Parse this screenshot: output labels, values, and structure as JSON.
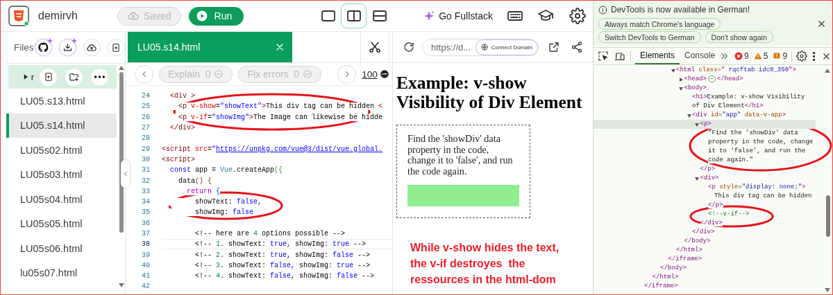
{
  "app_bar": {
    "project_name": "demirvh",
    "saved_button": {
      "label": "Saved",
      "disabled": true
    },
    "run_button": {
      "label": "Run"
    },
    "layouts": [
      {
        "kind": "single",
        "selected": false
      },
      {
        "kind": "columns",
        "selected": true
      },
      {
        "kind": "rows",
        "selected": false
      }
    ],
    "fullstack_button": {
      "label": "Go Fullstack"
    }
  },
  "sidebar": {
    "title": "Files",
    "folder": {
      "name": "r",
      "expanded": false
    },
    "files": [
      {
        "name": "LU05.s13.html",
        "selected": false
      },
      {
        "name": "LU05.s14.html",
        "selected": true
      },
      {
        "name": "LU05s02.html",
        "selected": false
      },
      {
        "name": "LU05s03.html",
        "selected": false
      },
      {
        "name": "LU05s04.html",
        "selected": false
      },
      {
        "name": "LU05s05.html",
        "selected": false
      },
      {
        "name": "LU05s06.html",
        "selected": false
      },
      {
        "name": "lu05s07.html",
        "selected": false
      }
    ]
  },
  "editor": {
    "tab": {
      "label": "LU05.s14.html"
    },
    "explain_button": {
      "label": "Explain",
      "count": "0",
      "disabled": true
    },
    "fix_button": {
      "label": "Fix errors",
      "count": "0",
      "disabled": true
    },
    "score": "100",
    "lines": [
      {
        "number": "24",
        "current": false,
        "tokens": [
          {
            "kind": "tag",
            "text": "  <div >"
          }
        ]
      },
      {
        "number": "25",
        "current": false,
        "tokens": [
          {
            "kind": "tag",
            "text": "    <p "
          },
          {
            "kind": "attr",
            "text": "v-show"
          },
          {
            "kind": "plain",
            "text": "="
          },
          {
            "kind": "str",
            "text": "\"showText\""
          },
          {
            "kind": "tag",
            "text": ">"
          },
          {
            "kind": "plain",
            "text": "This div tag can be hidden "
          },
          {
            "kind": "tag",
            "text": "<"
          }
        ]
      },
      {
        "number": "26",
        "current": false,
        "tokens": [
          {
            "kind": "tag",
            "text": "    <p "
          },
          {
            "kind": "attr",
            "text": "v-if"
          },
          {
            "kind": "plain",
            "text": "="
          },
          {
            "kind": "str",
            "text": "\"showImg\""
          },
          {
            "kind": "tag",
            "text": ">"
          },
          {
            "kind": "plain",
            "text": "The Image can likewise be hidde"
          }
        ]
      },
      {
        "number": "27",
        "current": false,
        "tokens": [
          {
            "kind": "tag",
            "text": "  </div>"
          }
        ]
      },
      {
        "number": "28",
        "current": false
      },
      {
        "number": "29",
        "current": false,
        "tokens": [
          {
            "kind": "tag",
            "text": "<script "
          },
          {
            "kind": "attr",
            "text": "src"
          },
          {
            "kind": "plain",
            "text": "="
          },
          {
            "kind": "str",
            "text": "\""
          },
          {
            "kind": "url",
            "text": "https://unpkg.com/vue@3/dist/vue.global."
          }
        ]
      },
      {
        "number": "30",
        "current": false,
        "tokens": [
          {
            "kind": "tag",
            "text": "<script>"
          }
        ]
      },
      {
        "number": "31",
        "current": false,
        "tokens": [
          {
            "kind": "kw",
            "text": "  const"
          },
          {
            "kind": "plain",
            "text": " app = "
          },
          {
            "kind": "cls",
            "text": "Vue"
          },
          {
            "kind": "plain",
            "text": ".createApp"
          },
          {
            "kind": "br1",
            "text": "({"
          }
        ]
      },
      {
        "number": "32",
        "current": false,
        "tokens": [
          {
            "kind": "plain",
            "text": "    data"
          },
          {
            "kind": "br2",
            "text": "() {"
          }
        ]
      },
      {
        "number": "33",
        "current": false,
        "tokens": [
          {
            "kind": "ctl",
            "text": "      return"
          },
          {
            "kind": "br3",
            "text": " {"
          }
        ]
      },
      {
        "number": "34",
        "current": false,
        "tokens": [
          {
            "kind": "plain",
            "text": "        showText: "
          },
          {
            "kind": "bool",
            "text": "false"
          },
          {
            "kind": "plain",
            "text": ","
          }
        ]
      },
      {
        "number": "35",
        "current": false,
        "tokens": [
          {
            "kind": "plain",
            "text": "        showImg: "
          },
          {
            "kind": "bool",
            "text": "false"
          }
        ]
      },
      {
        "number": "36",
        "current": false
      },
      {
        "number": "37",
        "current": false,
        "tokens": [
          {
            "kind": "plain",
            "text": "        <!-- here are "
          },
          {
            "kind": "num",
            "text": "4"
          },
          {
            "kind": "plain",
            "text": " options possible -->"
          }
        ]
      },
      {
        "number": "38",
        "current": true,
        "tokens": [
          {
            "kind": "plain",
            "text": "        <!-- "
          },
          {
            "kind": "num",
            "text": "1"
          },
          {
            "kind": "plain",
            "text": ". showText: "
          },
          {
            "kind": "bool",
            "text": "true"
          },
          {
            "kind": "plain",
            "text": ", showImg: "
          },
          {
            "kind": "bool",
            "text": "true"
          },
          {
            "kind": "plain",
            "text": " -->"
          }
        ]
      },
      {
        "number": "39",
        "current": false,
        "tokens": [
          {
            "kind": "plain",
            "text": "        <!-- "
          },
          {
            "kind": "num",
            "text": "2"
          },
          {
            "kind": "plain",
            "text": ". showText: "
          },
          {
            "kind": "bool",
            "text": "true"
          },
          {
            "kind": "plain",
            "text": ", showImg: "
          },
          {
            "kind": "bool",
            "text": "false"
          },
          {
            "kind": "plain",
            "text": " -->"
          }
        ]
      },
      {
        "number": "40",
        "current": false,
        "tokens": [
          {
            "kind": "plain",
            "text": "        <!-- "
          },
          {
            "kind": "num",
            "text": "3"
          },
          {
            "kind": "plain",
            "text": ". showText: "
          },
          {
            "kind": "bool",
            "text": "false"
          },
          {
            "kind": "plain",
            "text": ", showImg: "
          },
          {
            "kind": "bool",
            "text": "true"
          },
          {
            "kind": "plain",
            "text": " -->"
          }
        ]
      },
      {
        "number": "41",
        "current": false,
        "tokens": [
          {
            "kind": "plain",
            "text": "        <!-- "
          },
          {
            "kind": "num",
            "text": "4"
          },
          {
            "kind": "plain",
            "text": ". showText: "
          },
          {
            "kind": "bool",
            "text": "false"
          },
          {
            "kind": "plain",
            "text": ", showImg: "
          },
          {
            "kind": "bool",
            "text": "false"
          },
          {
            "kind": "plain",
            "text": " -->"
          }
        ]
      },
      {
        "number": "42",
        "current": false
      }
    ]
  },
  "preview": {
    "url": "https://d...",
    "connect_button": {
      "label": "Connect Domain"
    },
    "heading": "Example: v-show Visibility of Div Element",
    "paragraph": "Find the 'showDiv' data property in the code, change it to 'false', and run the code again.",
    "annotation": [
      "While v-show hides the text,",
      "the v-if destroyes  the",
      "ressources in the html-dom"
    ]
  },
  "devtools": {
    "infobar": {
      "message": "DevTools is now available in German!",
      "buttons": [
        "Always match Chrome's language",
        "Switch DevTools to German",
        "Don't show again"
      ]
    },
    "tabs": [
      {
        "label": "Elements",
        "selected": true
      },
      {
        "label": "Console",
        "selected": false
      }
    ],
    "issue_counts": {
      "errors": "9",
      "warnings": "5",
      "issues": "9"
    },
    "tree": [
      {
        "close": [
          {
            "kind": "tag",
            "text": "</iframe>"
          }
        ],
        "children": [
          {
            "close": [
              {
                "kind": "tag",
                "text": "</html>"
              }
            ],
            "children": [
              {
                "close": [
                  {
                    "kind": "tag",
                    "text": "</body>"
                  }
                ],
                "children": [
                  {
                    "close": [
                      {
                        "kind": "tag",
                        "text": "</iframe>"
                      }
                    ],
                    "children": [
                      {
                        "expanded": true,
                        "selected": false,
                        "open": [
                          {
                            "kind": "tag",
                            "text": "<html"
                          },
                          {
                            "kind": "attr",
                            "text": " class"
                          },
                          {
                            "kind": "tag",
                            "text": "=\""
                          },
                          {
                            "kind": "val",
                            "text": " rqcftab idc0_350"
                          },
                          {
                            "kind": "tag",
                            "text": "\">"
                          }
                        ],
                        "close": [
                          {
                            "kind": "tag",
                            "text": "</html>"
                          }
                        ],
                        "children": [
                          {
                            "expanded": false,
                            "selected": false,
                            "open": [
                              {
                                "kind": "tag",
                                "text": "<head>"
                              },
                              {
                                "kind": "more",
                                "text": "⋯"
                              },
                              {
                                "kind": "tag",
                                "text": "</head>"
                              }
                            ]
                          },
                          {
                            "expanded": true,
                            "selected": false,
                            "open": [
                              {
                                "kind": "tag",
                                "text": "<body>"
                              }
                            ],
                            "close": [
                              {
                                "kind": "tag",
                                "text": "</body>"
                              }
                            ],
                            "children": [
                              {
                                "selected": false,
                                "open": [
                                  {
                                    "kind": "tag",
                                    "text": "<h1>"
                                  },
                                  {
                                    "kind": "text",
                                    "text": "Example: v-show Visibility of Div Element"
                                  },
                                  {
                                    "kind": "tag",
                                    "text": "</h1>"
                                  }
                                ]
                              },
                              {
                                "expanded": true,
                                "selected": false,
                                "open": [
                                  {
                                    "kind": "tag",
                                    "text": "<div"
                                  },
                                  {
                                    "kind": "attr",
                                    "text": " id"
                                  },
                                  {
                                    "kind": "text",
                                    "text": "="
                                  },
                                  {
                                    "kind": "val",
                                    "text": "\"app\""
                                  },
                                  {
                                    "kind": "attr",
                                    "text": " data-v-app"
                                  },
                                  {
                                    "kind": "tag",
                                    "text": ">"
                                  }
                                ],
                                "close": [
                                  {
                                    "kind": "tag",
                                    "text": "</div>"
                                  }
                                ],
                                "children": [
                                  {
                                    "expanded": true,
                                    "selected": true,
                                    "open": [
                                      {
                                        "kind": "tag",
                                        "text": "<p>"
                                      }
                                    ],
                                    "close": [
                                      {
                                        "kind": "tag",
                                        "text": "</p>"
                                      }
                                    ],
                                    "children": [
                                      {
                                        "selected": false,
                                        "open": [
                                          {
                                            "kind": "text",
                                            "text": "\"Find the 'showDiv' data property in the code, change it to 'false', and run the code again.\""
                                          }
                                        ]
                                      }
                                    ]
                                  },
                                  {
                                    "expanded": true,
                                    "selected": false,
                                    "open": [
                                      {
                                        "kind": "tag",
                                        "text": "<div>"
                                      }
                                    ],
                                    "close": [
                                      {
                                        "kind": "tag",
                                        "text": "</div>"
                                      }
                                    ],
                                    "children": [
                                      {
                                        "selected": false,
                                        "open": [
                                          {
                                            "kind": "tag",
                                            "text": "<p"
                                          },
                                          {
                                            "kind": "attr",
                                            "text": " style"
                                          },
                                          {
                                            "kind": "text",
                                            "text": "="
                                          },
                                          {
                                            "kind": "val",
                                            "text": "\"display: none;\""
                                          },
                                          {
                                            "kind": "tag",
                                            "text": ">"
                                          }
                                        ],
                                        "inline": [
                                          {
                                            "kind": "text",
                                            "text": "This div tag can be hidden"
                                          }
                                        ],
                                        "close": [
                                          {
                                            "kind": "tag",
                                            "text": "</p>"
                                          }
                                        ]
                                      },
                                      {
                                        "selected": false,
                                        "open": [
                                          {
                                            "kind": "comment",
                                            "text": "<!--v-if-->"
                                          }
                                        ]
                                      }
                                    ]
                                  }
                                ]
                              }
                            ]
                          }
                        ]
                      }
                    ]
                  }
                ]
              }
            ]
          }
        ]
      }
    ]
  }
}
